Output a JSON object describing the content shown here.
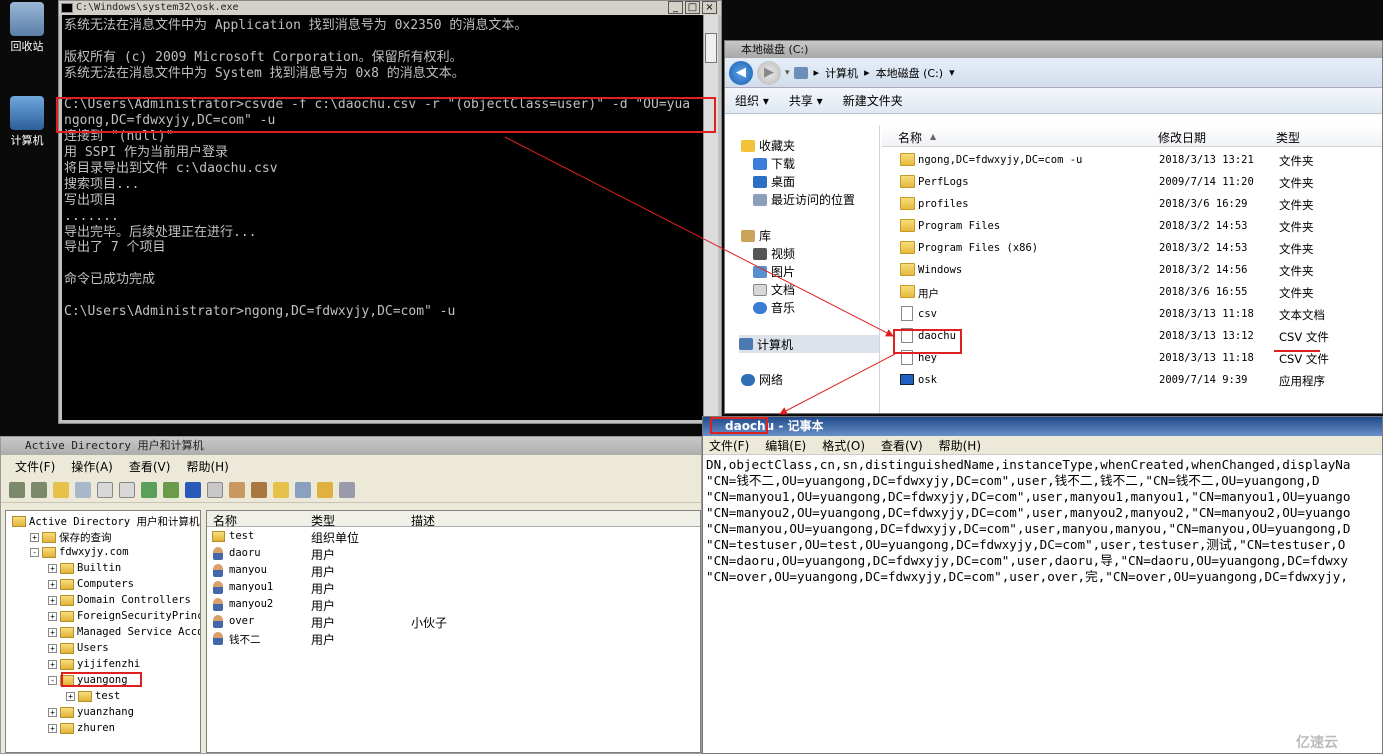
{
  "desktop": {
    "icons": [
      {
        "label": "回收站"
      },
      {
        "label": "计算机"
      }
    ]
  },
  "cmd": {
    "title": "C:\\Windows\\system32\\osk.exe",
    "lines": [
      "系统无法在消息文件中为 Application 找到消息号为 0x2350 的消息文本。",
      "",
      "版权所有 (c) 2009 Microsoft Corporation。保留所有权利。",
      "系统无法在消息文件中为 System 找到消息号为 0x8 的消息文本。",
      "",
      "C:\\Users\\Administrator>csvde -f c:\\daochu.csv -r \"(objectClass=user)\" -d \"OU=yua",
      "ngong,DC=fdwxyjy,DC=com\" -u",
      "连接到 \"(null)\"",
      "用 SSPI 作为当前用户登录",
      "将目录导出到文件 c:\\daochu.csv",
      "搜索项目...",
      "写出项目",
      ".......",
      "导出完毕。后续处理正在进行...",
      "导出了 7 个项目",
      "",
      "命令已成功完成",
      "",
      "C:\\Users\\Administrator>ngong,DC=fdwxyjy,DC=com\" -u"
    ]
  },
  "explorer": {
    "title": "本地磁盘 (C:)",
    "breadcrumb": [
      "计算机",
      "本地磁盘 (C:)"
    ],
    "commands": [
      "组织 ▾",
      "共享 ▾",
      "新建文件夹"
    ],
    "nav": {
      "favorites": "收藏夹",
      "fav_items": [
        "下载",
        "桌面",
        "最近访问的位置"
      ],
      "library": "库",
      "lib_items": [
        "视频",
        "图片",
        "文档",
        "音乐"
      ],
      "computer": "计算机",
      "network": "网络"
    },
    "columns": {
      "name": "名称",
      "date": "修改日期",
      "type": "类型"
    },
    "files": [
      {
        "name": "ngong,DC=fdwxyjy,DC=com -u",
        "date": "2018/3/13 13:21",
        "type": "文件夹",
        "icon": "folder"
      },
      {
        "name": "PerfLogs",
        "date": "2009/7/14 11:20",
        "type": "文件夹",
        "icon": "folder"
      },
      {
        "name": "profiles",
        "date": "2018/3/6 16:29",
        "type": "文件夹",
        "icon": "folder"
      },
      {
        "name": "Program Files",
        "date": "2018/3/2 14:53",
        "type": "文件夹",
        "icon": "folder"
      },
      {
        "name": "Program Files (x86)",
        "date": "2018/3/2 14:53",
        "type": "文件夹",
        "icon": "folder"
      },
      {
        "name": "Windows",
        "date": "2018/3/2 14:56",
        "type": "文件夹",
        "icon": "folder"
      },
      {
        "name": "用户",
        "date": "2018/3/6 16:55",
        "type": "文件夹",
        "icon": "folder"
      },
      {
        "name": "csv",
        "date": "2018/3/13 11:18",
        "type": "文本文档",
        "icon": "doc"
      },
      {
        "name": "daochu",
        "date": "2018/3/13 13:12",
        "type": "CSV 文件",
        "icon": "doc"
      },
      {
        "name": "hey",
        "date": "2018/3/13 11:18",
        "type": "CSV 文件",
        "icon": "doc"
      },
      {
        "name": "osk",
        "date": "2009/7/14 9:39",
        "type": "应用程序",
        "icon": "exe"
      }
    ]
  },
  "ad": {
    "title": "Active Directory 用户和计算机",
    "menu": [
      "文件(F)",
      "操作(A)",
      "查看(V)",
      "帮助(H)"
    ],
    "tree": [
      {
        "label": "Active Directory 用户和计算机",
        "level": 0,
        "pm": ""
      },
      {
        "label": "保存的查询",
        "level": 1,
        "pm": "+"
      },
      {
        "label": "fdwxyjy.com",
        "level": 1,
        "pm": "-"
      },
      {
        "label": "Builtin",
        "level": 2,
        "pm": "+"
      },
      {
        "label": "Computers",
        "level": 2,
        "pm": "+"
      },
      {
        "label": "Domain Controllers",
        "level": 2,
        "pm": "+"
      },
      {
        "label": "ForeignSecurityPrincip",
        "level": 2,
        "pm": "+"
      },
      {
        "label": "Managed Service Accour",
        "level": 2,
        "pm": "+"
      },
      {
        "label": "Users",
        "level": 2,
        "pm": "+"
      },
      {
        "label": "yijifenzhi",
        "level": 2,
        "pm": "+"
      },
      {
        "label": "yuangong",
        "level": 2,
        "pm": "-"
      },
      {
        "label": "test",
        "level": 3,
        "pm": "+"
      },
      {
        "label": "yuanzhang",
        "level": 2,
        "pm": "+"
      },
      {
        "label": "zhuren",
        "level": 2,
        "pm": "+"
      }
    ],
    "columns": {
      "name": "名称",
      "type": "类型",
      "desc": "描述"
    },
    "rows": [
      {
        "name": "test",
        "type": "组织单位",
        "desc": "",
        "icon": "ou"
      },
      {
        "name": "daoru",
        "type": "用户",
        "desc": "",
        "icon": "user"
      },
      {
        "name": "manyou",
        "type": "用户",
        "desc": "",
        "icon": "user"
      },
      {
        "name": "manyou1",
        "type": "用户",
        "desc": "",
        "icon": "user"
      },
      {
        "name": "manyou2",
        "type": "用户",
        "desc": "",
        "icon": "user"
      },
      {
        "name": "over",
        "type": "用户",
        "desc": "小伙子",
        "icon": "user"
      },
      {
        "name": "钱不二",
        "type": "用户",
        "desc": "",
        "icon": "user"
      }
    ]
  },
  "notepad": {
    "title_file": "daochu",
    "title_app": " - 记事本",
    "menu": [
      "文件(F)",
      "编辑(E)",
      "格式(O)",
      "查看(V)",
      "帮助(H)"
    ],
    "lines": [
      "DN,objectClass,cn,sn,distinguishedName,instanceType,whenCreated,whenChanged,displayNa",
      "\"CN=钱不二,OU=yuangong,DC=fdwxyjy,DC=com\",user,钱不二,钱不二,\"CN=钱不二,OU=yuangong,D",
      "\"CN=manyou1,OU=yuangong,DC=fdwxyjy,DC=com\",user,manyou1,manyou1,\"CN=manyou1,OU=yuango",
      "\"CN=manyou2,OU=yuangong,DC=fdwxyjy,DC=com\",user,manyou2,manyou2,\"CN=manyou2,OU=yuango",
      "\"CN=manyou,OU=yuangong,DC=fdwxyjy,DC=com\",user,manyou,manyou,\"CN=manyou,OU=yuangong,D",
      "\"CN=testuser,OU=test,OU=yuangong,DC=fdwxyjy,DC=com\",user,testuser,测试,\"CN=testuser,O",
      "\"CN=daoru,OU=yuangong,DC=fdwxyjy,DC=com\",user,daoru,导,\"CN=daoru,OU=yuangong,DC=fdwxy",
      "\"CN=over,OU=yuangong,DC=fdwxyjy,DC=com\",user,over,完,\"CN=over,OU=yuangong,DC=fdwxyjy,"
    ]
  },
  "watermark": "亿速云"
}
